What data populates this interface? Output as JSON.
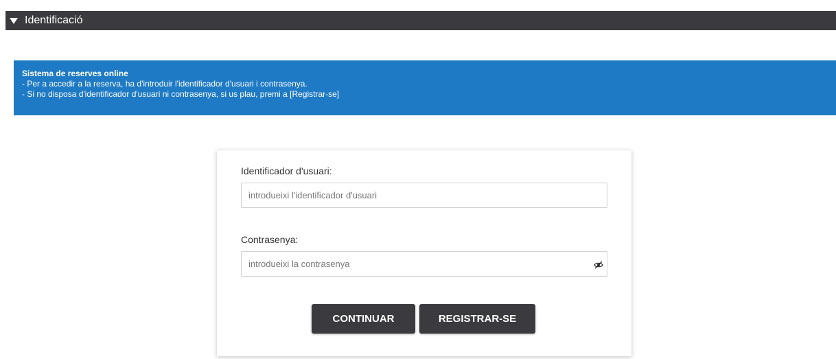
{
  "section": {
    "title": "Identificació",
    "caret_icon": "caret-down-icon"
  },
  "info": {
    "title": "Sistema de reserves online",
    "lines": [
      "- Per a accedir a la reserva, ha d'introduir l'identificador d'usuari i contrasenya.",
      "- Si no disposa d'identificador d'usuari ni contrasenya, si us plau, premi a [Registrar-se]"
    ],
    "background_color": "#1e7ac4"
  },
  "login": {
    "user_label": "Identificador d'usuari:",
    "user_placeholder": "introdueixi l'identificador d'usuari",
    "user_value": "",
    "password_label": "Contrasenya:",
    "password_placeholder": "introdueixi la contrasenya",
    "password_value": "",
    "password_toggle_icon": "eye-slash-icon",
    "continue_label": "CONTINUAR",
    "register_label": "REGISTRAR-SE",
    "button_color": "#3b3b3f"
  }
}
